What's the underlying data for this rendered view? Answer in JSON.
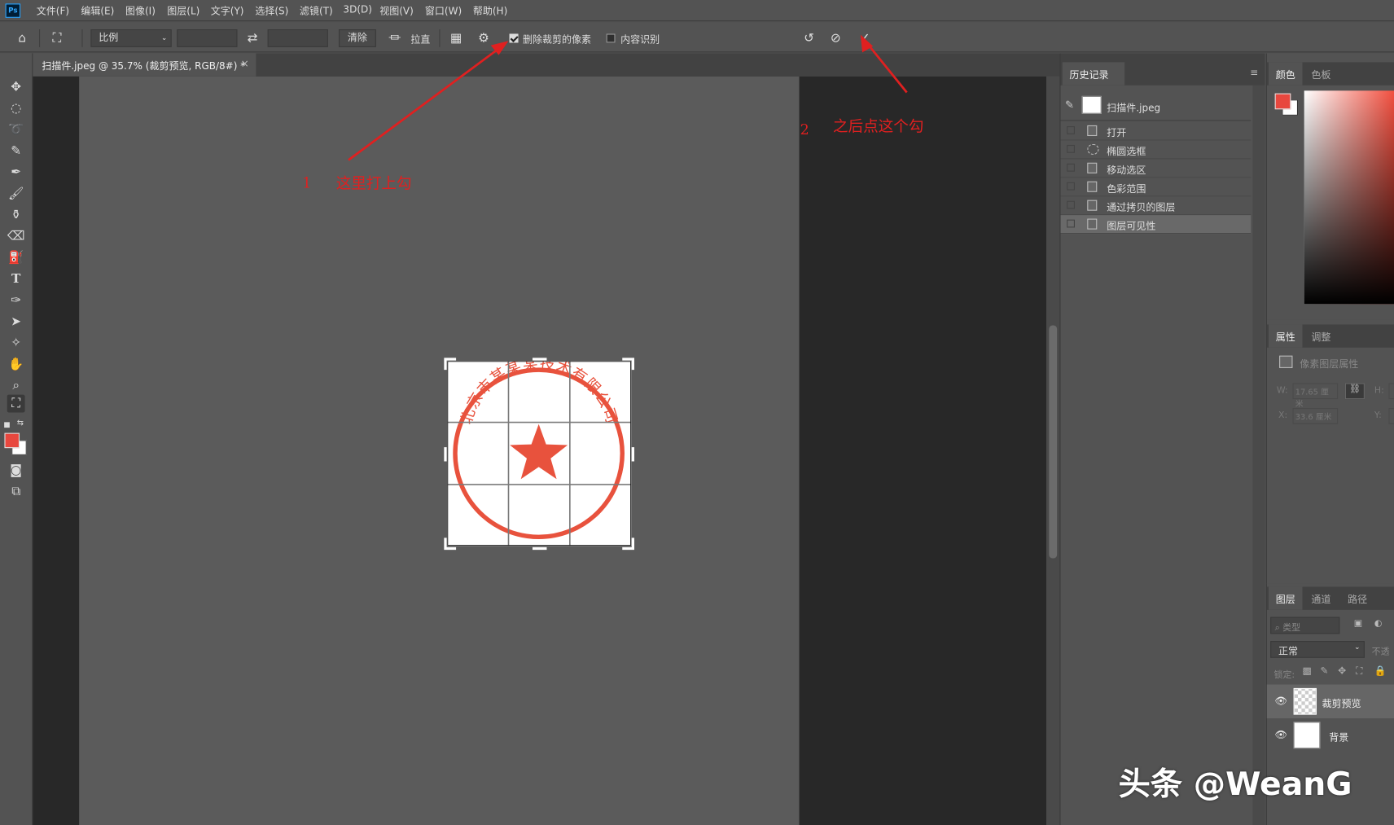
{
  "app": {
    "name": "Ps",
    "accent_color": "#31a8ff"
  },
  "menu": {
    "items": [
      "文件(F)",
      "编辑(E)",
      "图像(I)",
      "图层(L)",
      "文字(Y)",
      "选择(S)",
      "滤镜(T)",
      "3D(D)",
      "视图(V)",
      "窗口(W)",
      "帮助(H)"
    ]
  },
  "options": {
    "ratio_select": "比例",
    "clear_button": "清除",
    "straighten_label": "拉直",
    "delete_cropped_label": "删除裁剪的像素",
    "delete_cropped_checked": true,
    "content_aware_label": "内容识别",
    "content_aware_checked": false
  },
  "document": {
    "tab_title": "扫描件.jpeg @ 35.7% (裁剪预览, RGB/8#) *",
    "close_glyph": "×"
  },
  "stamp": {
    "company_name": "北京市某某某技术有限公司",
    "color": "#e8523d"
  },
  "history": {
    "tab": "历史记录",
    "snapshot_name": "扫描件.jpeg",
    "items": [
      {
        "label": "打开",
        "icon": "document-icon"
      },
      {
        "label": "椭圆选框",
        "icon": "ellipse-marquee-icon"
      },
      {
        "label": "移动选区",
        "icon": "document-icon"
      },
      {
        "label": "色彩范围",
        "icon": "document-icon"
      },
      {
        "label": "通过拷贝的图层",
        "icon": "document-icon"
      },
      {
        "label": "图层可见性",
        "icon": "document-icon",
        "selected": true
      }
    ]
  },
  "color_panel": {
    "tabs": [
      "颜色",
      "色板"
    ],
    "foreground": "#e8473e",
    "background": "#ffffff"
  },
  "properties": {
    "tabs": [
      "属性",
      "调整"
    ],
    "type_label": "像素图层属性",
    "w_label": "W:",
    "w_value": "17.65 厘米",
    "h_label": "H:",
    "x_label": "X:",
    "x_value": "33.6 厘米",
    "y_label": "Y:"
  },
  "layers": {
    "tabs": [
      "图层",
      "通道",
      "路径"
    ],
    "kind_placeholder": "类型",
    "blend_mode": "正常",
    "opacity_label": "不透",
    "lock_label": "锁定:",
    "items": [
      {
        "name": "裁剪预览",
        "visible": true
      },
      {
        "name": "背景",
        "visible": true
      }
    ]
  },
  "annotations": {
    "step1_number": "1",
    "step1_text": "这里打上勾",
    "step2_number": "2",
    "step2_text": "之后点这个勾",
    "watermark": "头条 @WeanG",
    "color": "#e02020"
  }
}
